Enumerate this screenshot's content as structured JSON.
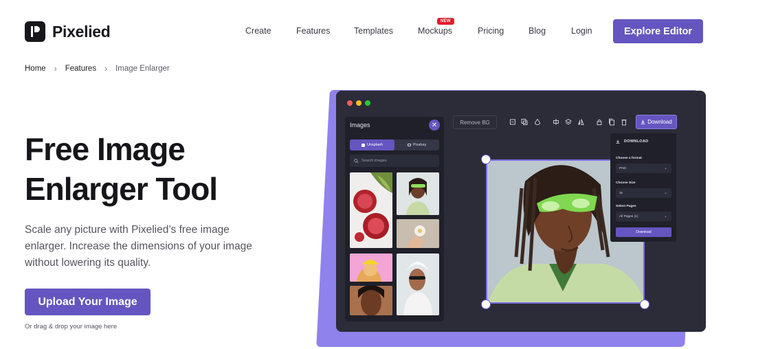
{
  "brand": {
    "name": "Pixelied"
  },
  "nav": {
    "items": [
      {
        "label": "Create"
      },
      {
        "label": "Features"
      },
      {
        "label": "Templates"
      },
      {
        "label": "Mockups",
        "badge": "NEW"
      },
      {
        "label": "Pricing"
      },
      {
        "label": "Blog"
      },
      {
        "label": "Login"
      }
    ],
    "cta": "Explore Editor"
  },
  "breadcrumb": {
    "items": [
      "Home",
      "Features"
    ],
    "current": "Image Enlarger",
    "separator": "›"
  },
  "hero": {
    "title_line1": "Free Image",
    "title_line2": "Enlarger Tool",
    "description": "Scale any picture with Pixelied’s free image enlarger. Increase the dimensions of your image without lowering its quality.",
    "upload_label": "Upload Your Image",
    "drag_note": "Or drag & drop your image here"
  },
  "editor": {
    "panel_title": "Images",
    "close_glyph": "✕",
    "tabs": [
      "Unsplash",
      "Pixabay"
    ],
    "search_placeholder": "Search images",
    "remove_bg": "Remove BG",
    "download": "Download",
    "download_panel": {
      "title": "DOWNLOAD",
      "format_label": "Choose a format",
      "format_value": "PNG",
      "size_label": "Choose Size",
      "size_value": "3x",
      "pages_label": "Select Pages",
      "pages_value": "All Pages (1)",
      "confirm": "Download"
    }
  },
  "colors": {
    "accent": "#6555c0",
    "mock_bg": "#2b2c38",
    "mock_shadow": "#8f82ec",
    "dot_red": "#ff5f57",
    "dot_yellow": "#febc2e",
    "dot_green": "#28c840",
    "new_badge": "#e51d2b"
  }
}
